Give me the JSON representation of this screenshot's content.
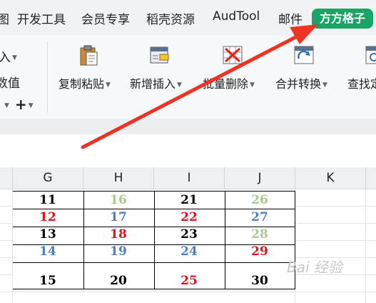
{
  "tabs": [
    "图",
    "开发工具",
    "会员专享",
    "稻壳资源",
    "AudTool",
    "邮件"
  ],
  "active_tab": "方方格子",
  "ribbon_left": {
    "top": "入",
    "middle": "数值",
    "plus": "+"
  },
  "ribbon_buttons": [
    {
      "label": "复制粘贴",
      "icon": "clipboard-icon"
    },
    {
      "label": "新增插入",
      "icon": "insert-icon"
    },
    {
      "label": "批量删除",
      "icon": "delete-icon"
    },
    {
      "label": "合并转换",
      "icon": "merge-icon"
    },
    {
      "label": "查找定",
      "icon": "find-icon"
    }
  ],
  "columns": [
    "G",
    "H",
    "I",
    "J",
    "K"
  ],
  "rows": [
    [
      {
        "v": "11",
        "c": "#000000"
      },
      {
        "v": "16",
        "c": "#a9c98f"
      },
      {
        "v": "21",
        "c": "#000000"
      },
      {
        "v": "26",
        "c": "#a9c98f"
      }
    ],
    [
      {
        "v": "12",
        "c": "#e0101c"
      },
      {
        "v": "17",
        "c": "#4a7fc0"
      },
      {
        "v": "22",
        "c": "#e0101c"
      },
      {
        "v": "27",
        "c": "#4a7fc0"
      }
    ],
    [
      {
        "v": "13",
        "c": "#000000"
      },
      {
        "v": "18",
        "c": "#e0101c"
      },
      {
        "v": "23",
        "c": "#000000"
      },
      {
        "v": "28",
        "c": "#a9c98f"
      }
    ],
    [
      {
        "v": "14",
        "c": "#4a7fc0"
      },
      {
        "v": "19",
        "c": "#4a7fc0"
      },
      {
        "v": "24",
        "c": "#4a7fc0"
      },
      {
        "v": "29",
        "c": "#e0101c"
      }
    ],
    [
      {
        "v": "15",
        "c": "#000000"
      },
      {
        "v": "20",
        "c": "#000000"
      },
      {
        "v": "25",
        "c": "#e0101c"
      },
      {
        "v": "30",
        "c": "#000000"
      }
    ]
  ],
  "watermark": "Bai 经验",
  "colors": {
    "active_tab": "#19a566",
    "arrow": "#ee3322"
  }
}
